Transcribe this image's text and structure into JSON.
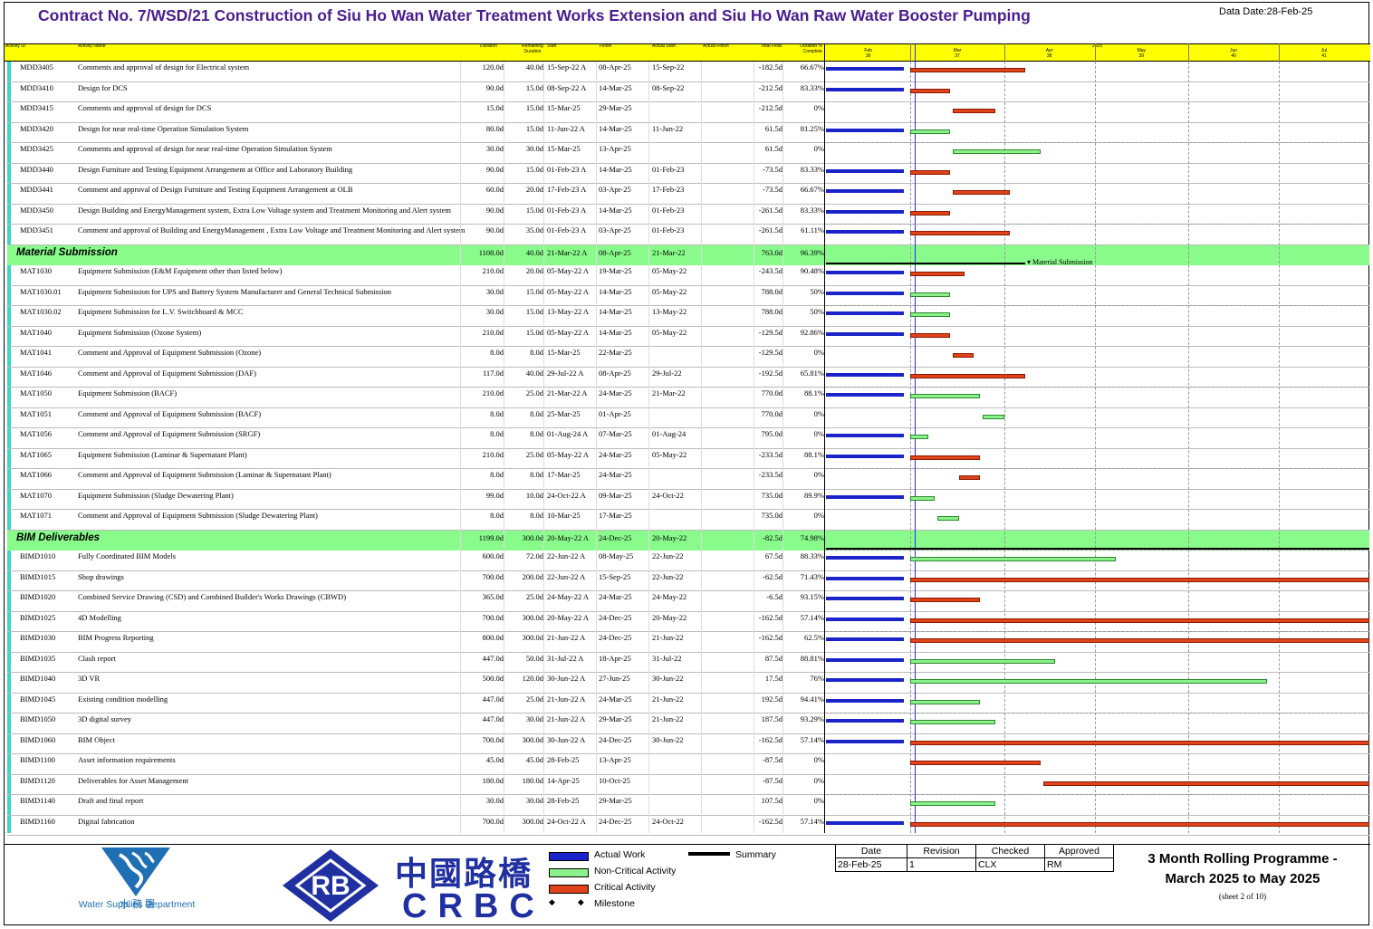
{
  "header": {
    "title": "Contract No. 7/WSD/21 Construction of Siu Ho Wan Water Treatment Works Extension and Siu Ho Wan Raw Water Booster Pumping",
    "data_date": "Data Date:28-Feb-25"
  },
  "columns": {
    "id": "Activity ID",
    "name": "Activity Name",
    "duration": "Duration",
    "remaining": "Remaining Duration",
    "start": "Start",
    "finish": "Finish",
    "actual_start": "Actual Start",
    "actual_finish": "Actual Finish",
    "total_float": "Total Float",
    "pct": "Duration % Complete"
  },
  "timeline": {
    "year": "2025",
    "months": [
      "Feb",
      "Mar",
      "Apr",
      "May",
      "Jun",
      "Jul"
    ],
    "weeks": [
      "36",
      "37",
      "38",
      "39",
      "40",
      "41"
    ]
  },
  "chart_data": {
    "type": "gantt",
    "data_date": "28-Feb-25",
    "axis_range": [
      "2025-02-01",
      "2025-07-31"
    ],
    "rows": [
      {
        "type": "task",
        "id": "MDD3405",
        "name": "Comments and approval of design for Electrical system",
        "dur": "120.0d",
        "rem": "40.0d",
        "start": "15-Sep-22 A",
        "finish": "08-Apr-25",
        "astart": "15-Sep-22",
        "tf": "-182.5d",
        "pct": "66.67%",
        "bar": "crit",
        "bstart": "2025-03-01",
        "bend": "2025-04-08",
        "actual": true
      },
      {
        "type": "task",
        "id": "MDD3410",
        "name": "Design for DCS",
        "dur": "90.0d",
        "rem": "15.0d",
        "start": "08-Sep-22 A",
        "finish": "14-Mar-25",
        "astart": "08-Sep-22",
        "tf": "-212.5d",
        "pct": "83.33%",
        "bar": "crit",
        "bstart": "2025-03-01",
        "bend": "2025-03-14",
        "actual": true
      },
      {
        "type": "task",
        "id": "MDD3415",
        "name": "Comments and approval of design for DCS",
        "dur": "15.0d",
        "rem": "15.0d",
        "start": "15-Mar-25",
        "finish": "29-Mar-25",
        "astart": "",
        "tf": "-212.5d",
        "pct": "0%",
        "bar": "crit",
        "bstart": "2025-03-15",
        "bend": "2025-03-29",
        "actual": false
      },
      {
        "type": "task",
        "id": "MDD3420",
        "name": "Design for near real-time Operation Simulation System",
        "dur": "80.0d",
        "rem": "15.0d",
        "start": "11-Jun-22 A",
        "finish": "14-Mar-25",
        "astart": "11-Jun-22",
        "tf": "61.5d",
        "pct": "81.25%",
        "bar": "noncrit",
        "bstart": "2025-03-01",
        "bend": "2025-03-14",
        "actual": true
      },
      {
        "type": "task",
        "id": "MDD3425",
        "name": "Comments and approval of design for near real-time Operation Simulation System",
        "dur": "30.0d",
        "rem": "30.0d",
        "start": "15-Mar-25",
        "finish": "13-Apr-25",
        "astart": "",
        "tf": "61.5d",
        "pct": "0%",
        "bar": "noncrit",
        "bstart": "2025-03-15",
        "bend": "2025-04-13",
        "actual": false
      },
      {
        "type": "task",
        "id": "MDD3440",
        "name": "Design Furniture and Testing Equipment Arrangement at Office and Laboratory Building",
        "dur": "90.0d",
        "rem": "15.0d",
        "start": "01-Feb-23 A",
        "finish": "14-Mar-25",
        "astart": "01-Feb-23",
        "tf": "-73.5d",
        "pct": "83.33%",
        "bar": "crit",
        "bstart": "2025-03-01",
        "bend": "2025-03-14",
        "actual": true
      },
      {
        "type": "task",
        "id": "MDD3441",
        "name": "Comment and approval of Design Furniture and Testing Equipment Arrangement at OLB",
        "dur": "60.0d",
        "rem": "20.0d",
        "start": "17-Feb-23 A",
        "finish": "03-Apr-25",
        "astart": "17-Feb-23",
        "tf": "-73.5d",
        "pct": "66.67%",
        "bar": "crit",
        "bstart": "2025-03-15",
        "bend": "2025-04-03",
        "actual": true
      },
      {
        "type": "task",
        "id": "MDD3450",
        "name": "Design Building and EnergyManagement system, Extra Low Voltage system and Treatment Monitoring and Alert system",
        "dur": "90.0d",
        "rem": "15.0d",
        "start": "01-Feb-23 A",
        "finish": "14-Mar-25",
        "astart": "01-Feb-23",
        "tf": "-261.5d",
        "pct": "83.33%",
        "bar": "crit",
        "bstart": "2025-03-01",
        "bend": "2025-03-14",
        "actual": true
      },
      {
        "type": "task",
        "id": "MDD3451",
        "name": "Comment and approval of Building and EnergyManagement , Extra Low Voltage and Treatment Monitoring and Alert system",
        "dur": "90.0d",
        "rem": "35.0d",
        "start": "01-Feb-23 A",
        "finish": "03-Apr-25",
        "astart": "01-Feb-23",
        "tf": "-261.5d",
        "pct": "61.11%",
        "bar": "crit",
        "bstart": "2025-03-01",
        "bend": "2025-04-03",
        "actual": true
      },
      {
        "type": "wbs",
        "id": "",
        "name": "Material Submission",
        "dur": "1108.0d",
        "rem": "40.0d",
        "start": "21-Mar-22 A",
        "finish": "08-Apr-25",
        "astart": "21-Mar-22",
        "tf": "763.0d",
        "pct": "96.39%",
        "bar": "summary",
        "bstart": "2025-02-01",
        "bend": "2025-04-08",
        "label": "Material Submission"
      },
      {
        "type": "task",
        "id": "MAT1030",
        "name": "Equipment Submission (E&M Equipment other than listed below)",
        "dur": "210.0d",
        "rem": "20.0d",
        "start": "05-May-22 A",
        "finish": "19-Mar-25",
        "astart": "05-May-22",
        "tf": "-243.5d",
        "pct": "90.48%",
        "bar": "crit",
        "bstart": "2025-03-01",
        "bend": "2025-03-19",
        "actual": true
      },
      {
        "type": "task",
        "id": "MAT1030.01",
        "name": "Equipment Submission for UPS and Battery System Manufacturer and General Technical Submission",
        "dur": "30.0d",
        "rem": "15.0d",
        "start": "05-May-22 A",
        "finish": "14-Mar-25",
        "astart": "05-May-22",
        "tf": "788.0d",
        "pct": "50%",
        "bar": "noncrit",
        "bstart": "2025-03-01",
        "bend": "2025-03-14",
        "actual": true
      },
      {
        "type": "task",
        "id": "MAT1030.02",
        "name": "Equipment Submission for L.V. Switchboard & MCC",
        "dur": "30.0d",
        "rem": "15.0d",
        "start": "13-May-22 A",
        "finish": "14-Mar-25",
        "astart": "13-May-22",
        "tf": "788.0d",
        "pct": "50%",
        "bar": "noncrit",
        "bstart": "2025-03-01",
        "bend": "2025-03-14",
        "actual": true
      },
      {
        "type": "task",
        "id": "MAT1040",
        "name": "Equipment Submission (Ozone System)",
        "dur": "210.0d",
        "rem": "15.0d",
        "start": "05-May-22 A",
        "finish": "14-Mar-25",
        "astart": "05-May-22",
        "tf": "-129.5d",
        "pct": "92.86%",
        "bar": "crit",
        "bstart": "2025-03-01",
        "bend": "2025-03-14",
        "actual": true
      },
      {
        "type": "task",
        "id": "MAT1041",
        "name": "Comment and Approval of Equipment Submission (Ozone)",
        "dur": "8.0d",
        "rem": "8.0d",
        "start": "15-Mar-25",
        "finish": "22-Mar-25",
        "astart": "",
        "tf": "-129.5d",
        "pct": "0%",
        "bar": "crit",
        "bstart": "2025-03-15",
        "bend": "2025-03-22",
        "actual": false
      },
      {
        "type": "task",
        "id": "MAT1046",
        "name": "Comment and Approval of Equipment Submission (DAF)",
        "dur": "117.0d",
        "rem": "40.0d",
        "start": "29-Jul-22 A",
        "finish": "08-Apr-25",
        "astart": "29-Jul-22",
        "tf": "-192.5d",
        "pct": "65.81%",
        "bar": "crit",
        "bstart": "2025-03-01",
        "bend": "2025-04-08",
        "actual": true
      },
      {
        "type": "task",
        "id": "MAT1050",
        "name": "Equipment Submission (BACF)",
        "dur": "210.0d",
        "rem": "25.0d",
        "start": "21-Mar-22 A",
        "finish": "24-Mar-25",
        "astart": "21-Mar-22",
        "tf": "770.0d",
        "pct": "88.1%",
        "bar": "noncrit",
        "bstart": "2025-03-01",
        "bend": "2025-03-24",
        "actual": true
      },
      {
        "type": "task",
        "id": "MAT1051",
        "name": "Comment and Approval of Equipment Submission (BACF)",
        "dur": "8.0d",
        "rem": "8.0d",
        "start": "25-Mar-25",
        "finish": "01-Apr-25",
        "astart": "",
        "tf": "770.0d",
        "pct": "0%",
        "bar": "noncrit",
        "bstart": "2025-03-25",
        "bend": "2025-04-01",
        "actual": false
      },
      {
        "type": "task",
        "id": "MAT1056",
        "name": "Comment and Approval of Equipment Submission (SRGF)",
        "dur": "8.0d",
        "rem": "8.0d",
        "start": "01-Aug-24 A",
        "finish": "07-Mar-25",
        "astart": "01-Aug-24",
        "tf": "795.0d",
        "pct": "0%",
        "bar": "noncrit",
        "bstart": "2025-03-01",
        "bend": "2025-03-07",
        "actual": true
      },
      {
        "type": "task",
        "id": "MAT1065",
        "name": "Equipment Submission (Laminar & Supernatant Plant)",
        "dur": "210.0d",
        "rem": "25.0d",
        "start": "05-May-22 A",
        "finish": "24-Mar-25",
        "astart": "05-May-22",
        "tf": "-233.5d",
        "pct": "88.1%",
        "bar": "crit",
        "bstart": "2025-03-01",
        "bend": "2025-03-24",
        "actual": true
      },
      {
        "type": "task",
        "id": "MAT1066",
        "name": "Comment and Approval of Equipment Submission (Laminar & Supernatant Plant)",
        "dur": "8.0d",
        "rem": "8.0d",
        "start": "17-Mar-25",
        "finish": "24-Mar-25",
        "astart": "",
        "tf": "-233.5d",
        "pct": "0%",
        "bar": "crit",
        "bstart": "2025-03-17",
        "bend": "2025-03-24",
        "actual": false
      },
      {
        "type": "task",
        "id": "MAT1070",
        "name": "Equipment Submission (Sludge Dewatering Plant)",
        "dur": "99.0d",
        "rem": "10.0d",
        "start": "24-Oct-22 A",
        "finish": "09-Mar-25",
        "astart": "24-Oct-22",
        "tf": "735.0d",
        "pct": "89.9%",
        "bar": "noncrit",
        "bstart": "2025-03-01",
        "bend": "2025-03-09",
        "actual": true
      },
      {
        "type": "task",
        "id": "MAT1071",
        "name": "Comment and Approval of Equipment Submission (Sludge Dewatering Plant)",
        "dur": "8.0d",
        "rem": "8.0d",
        "start": "10-Mar-25",
        "finish": "17-Mar-25",
        "astart": "",
        "tf": "735.0d",
        "pct": "0%",
        "bar": "noncrit",
        "bstart": "2025-03-10",
        "bend": "2025-03-17",
        "actual": false
      },
      {
        "type": "wbs",
        "id": "",
        "name": "BIM Deliverables",
        "dur": "1199.0d",
        "rem": "300.0d",
        "start": "20-May-22 A",
        "finish": "24-Dec-25",
        "astart": "20-May-22",
        "tf": "-82.5d",
        "pct": "74.98%",
        "bar": "summary",
        "bstart": "2025-02-01",
        "bend": "2025-07-31",
        "label": ""
      },
      {
        "type": "task",
        "id": "BIMD1010",
        "name": "Fully Coordinated BIM Models",
        "dur": "600.0d",
        "rem": "72.0d",
        "start": "22-Jun-22 A",
        "finish": "08-May-25",
        "astart": "22-Jun-22",
        "tf": "67.5d",
        "pct": "88.33%",
        "bar": "noncrit",
        "bstart": "2025-03-01",
        "bend": "2025-05-08",
        "actual": true
      },
      {
        "type": "task",
        "id": "BIMD1015",
        "name": "Shop drawings",
        "dur": "700.0d",
        "rem": "200.0d",
        "start": "22-Jun-22 A",
        "finish": "15-Sep-25",
        "astart": "22-Jun-22",
        "tf": "-62.5d",
        "pct": "71.43%",
        "bar": "crit",
        "bstart": "2025-03-01",
        "bend": "2025-07-31",
        "actual": true
      },
      {
        "type": "task",
        "id": "BIMD1020",
        "name": "Combined Service Drawing (CSD) and Combined Builder's Works Drawings (CBWD)",
        "dur": "365.0d",
        "rem": "25.0d",
        "start": "24-May-22 A",
        "finish": "24-Mar-25",
        "astart": "24-May-22",
        "tf": "-6.5d",
        "pct": "93.15%",
        "bar": "crit",
        "bstart": "2025-03-01",
        "bend": "2025-03-24",
        "actual": true
      },
      {
        "type": "task",
        "id": "BIMD1025",
        "name": "4D Modelling",
        "dur": "700.0d",
        "rem": "300.0d",
        "start": "20-May-22 A",
        "finish": "24-Dec-25",
        "astart": "20-May-22",
        "tf": "-162.5d",
        "pct": "57.14%",
        "bar": "crit",
        "bstart": "2025-03-01",
        "bend": "2025-07-31",
        "actual": true
      },
      {
        "type": "task",
        "id": "BIMD1030",
        "name": "BIM Progress Reporting",
        "dur": "800.0d",
        "rem": "300.0d",
        "start": "21-Jun-22 A",
        "finish": "24-Dec-25",
        "astart": "21-Jun-22",
        "tf": "-162.5d",
        "pct": "62.5%",
        "bar": "crit",
        "bstart": "2025-03-01",
        "bend": "2025-07-31",
        "actual": true
      },
      {
        "type": "task",
        "id": "BIMD1035",
        "name": "Clash report",
        "dur": "447.0d",
        "rem": "50.0d",
        "start": "31-Jul-22 A",
        "finish": "18-Apr-25",
        "astart": "31-Jul-22",
        "tf": "87.5d",
        "pct": "88.81%",
        "bar": "noncrit",
        "bstart": "2025-03-01",
        "bend": "2025-04-18",
        "actual": true
      },
      {
        "type": "task",
        "id": "BIMD1040",
        "name": "3D VR",
        "dur": "500.0d",
        "rem": "120.0d",
        "start": "30-Jun-22 A",
        "finish": "27-Jun-25",
        "astart": "30-Jun-22",
        "tf": "17.5d",
        "pct": "76%",
        "bar": "noncrit",
        "bstart": "2025-03-01",
        "bend": "2025-06-27",
        "actual": true
      },
      {
        "type": "task",
        "id": "BIMD1045",
        "name": "Existing condition modelling",
        "dur": "447.0d",
        "rem": "25.0d",
        "start": "21-Jun-22 A",
        "finish": "24-Mar-25",
        "astart": "21-Jun-22",
        "tf": "192.5d",
        "pct": "94.41%",
        "bar": "noncrit",
        "bstart": "2025-03-01",
        "bend": "2025-03-24",
        "actual": true
      },
      {
        "type": "task",
        "id": "BIMD1050",
        "name": "3D digital survey",
        "dur": "447.0d",
        "rem": "30.0d",
        "start": "21-Jun-22 A",
        "finish": "29-Mar-25",
        "astart": "21-Jun-22",
        "tf": "187.5d",
        "pct": "93.29%",
        "bar": "noncrit",
        "bstart": "2025-03-01",
        "bend": "2025-03-29",
        "actual": true
      },
      {
        "type": "task",
        "id": "BIMD1060",
        "name": "BIM Object",
        "dur": "700.0d",
        "rem": "300.0d",
        "start": "30-Jun-22 A",
        "finish": "24-Dec-25",
        "astart": "30-Jun-22",
        "tf": "-162.5d",
        "pct": "57.14%",
        "bar": "crit",
        "bstart": "2025-03-01",
        "bend": "2025-07-31",
        "actual": true
      },
      {
        "type": "task",
        "id": "BIMD1100",
        "name": "Asset information requirements",
        "dur": "45.0d",
        "rem": "45.0d",
        "start": "28-Feb-25",
        "finish": "13-Apr-25",
        "astart": "",
        "tf": "-87.5d",
        "pct": "0%",
        "bar": "crit",
        "bstart": "2025-03-01",
        "bend": "2025-04-13",
        "actual": false
      },
      {
        "type": "task",
        "id": "BIMD1120",
        "name": "Deliverables for Asset Management",
        "dur": "180.0d",
        "rem": "180.0d",
        "start": "14-Apr-25",
        "finish": "10-Oct-25",
        "astart": "",
        "tf": "-87.5d",
        "pct": "0%",
        "bar": "crit",
        "bstart": "2025-04-14",
        "bend": "2025-07-31",
        "actual": false
      },
      {
        "type": "task",
        "id": "BIMD1140",
        "name": "Draft and final report",
        "dur": "30.0d",
        "rem": "30.0d",
        "start": "28-Feb-25",
        "finish": "29-Mar-25",
        "astart": "",
        "tf": "107.5d",
        "pct": "0%",
        "bar": "noncrit",
        "bstart": "2025-03-01",
        "bend": "2025-03-29",
        "actual": false
      },
      {
        "type": "task",
        "id": "BIMD1160",
        "name": "Digital fabrication",
        "dur": "700.0d",
        "rem": "300.0d",
        "start": "24-Oct-22 A",
        "finish": "24-Dec-25",
        "astart": "24-Oct-22",
        "tf": "-162.5d",
        "pct": "57.14%",
        "bar": "crit",
        "bstart": "2025-03-01",
        "bend": "2025-07-31",
        "actual": true
      }
    ]
  },
  "legend": {
    "actual": "Actual Work",
    "noncrit": "Non-Critical Activity",
    "crit": "Critical Activity",
    "milestone": "Milestone",
    "summary": "Summary",
    "colors": {
      "actual": "#1a24c8",
      "noncrit": "#8cf08c",
      "crit": "#e0421a",
      "summary": "#000000"
    }
  },
  "revision": {
    "headers": [
      "Date",
      "Revision",
      "Checked",
      "Approved"
    ],
    "values": [
      "28-Feb-25",
      "1",
      "CLX",
      "RM"
    ]
  },
  "footer": {
    "program_title_1": "3 Month Rolling Programme -",
    "program_title_2": "March 2025 to May 2025",
    "sheet": "(sheet 2 of 10)",
    "wsd_name": "Water Supplies Department",
    "wsd_cn": "水務署",
    "crbc_cn": "中國路橋",
    "crbc_en": "CRBC",
    "crbc_mark": "RB"
  }
}
